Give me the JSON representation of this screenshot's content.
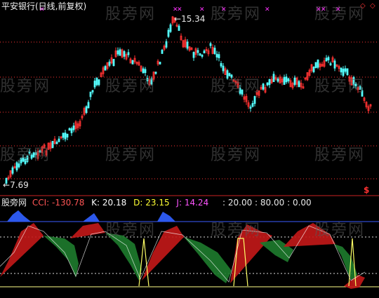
{
  "title": "平安银行(日线,前复权)",
  "price": {
    "high_label": "15.34",
    "low_label": "7.69"
  },
  "indicator": {
    "name": "股旁网",
    "cci_label": "CCI:",
    "cci_value": "-130.78",
    "k_label": "K:",
    "k_value": "20.18",
    "d_label": "D:",
    "d_value": "23.15",
    "j_label": "J:",
    "j_value": "14.24",
    "levels_text": ": 20.00 : 80.00 : 0.00"
  },
  "watermark": "股旁网",
  "corner_marks": [
    "◇",
    "◇"
  ],
  "dollar_mark": "$",
  "colors": {
    "up": "#ff3232",
    "down": "#54ffff",
    "guide": "#ff3232",
    "cci": "#ffffff",
    "k": "#ffffff",
    "d": "#ffff00",
    "j": "#ff44ff",
    "blue_area": "#3060ff",
    "red_area": "#c01818",
    "green_area": "#1d7a2c"
  }
}
